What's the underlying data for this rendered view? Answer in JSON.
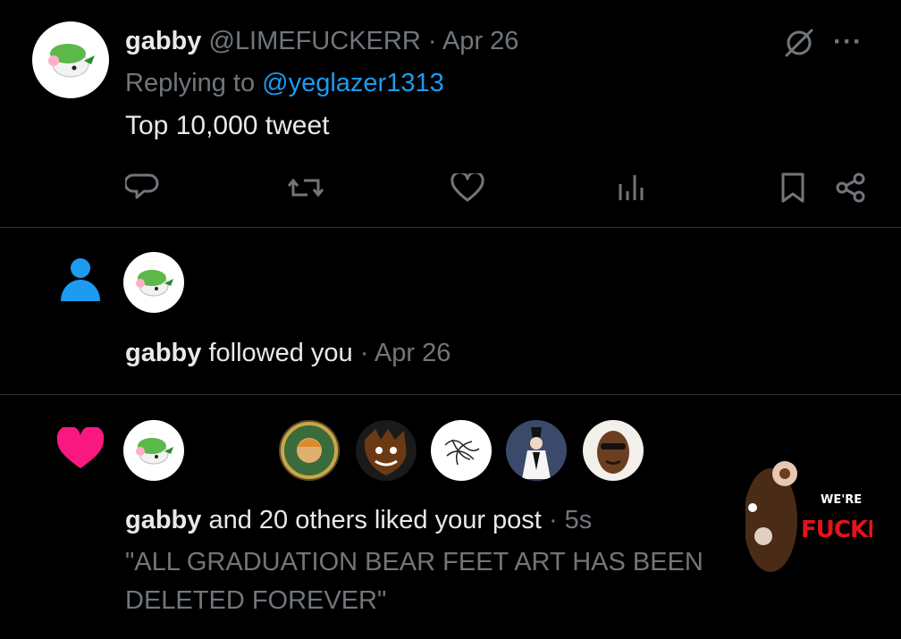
{
  "reply_tweet": {
    "display_name": "gabby",
    "handle": "@LIMEFUCKERR",
    "separator": "·",
    "date": "Apr 26",
    "replying_prefix": "Replying to",
    "replying_handle": "@yeglazer1313",
    "text": "Top 10,000 tweet",
    "more_label": "···",
    "actions": [
      "reply-icon",
      "retweet-icon",
      "like-icon",
      "views-icon",
      "bookmark-icon",
      "share-icon"
    ]
  },
  "follow_notification": {
    "icon": "person-icon",
    "name": "gabby",
    "text": "followed you",
    "separator": "·",
    "date": "Apr 26"
  },
  "like_notification": {
    "icon": "heart-icon",
    "name": "gabby",
    "text": "and 20 others liked your post",
    "separator": "·",
    "time": "5s",
    "post_text": "\"ALL GRADUATION BEAR FEET ART HAS BEEN DELETED FOREVER\"",
    "thumbnail_text_line1": "WE'RE",
    "thumbnail_text_line2": "FUCKE"
  },
  "colors": {
    "background": "#000000",
    "text": "#e7e9ea",
    "muted": "#71767b",
    "accent_blue": "#1d9bf0",
    "heart_pink": "#f91880",
    "divider": "#2f3336"
  }
}
